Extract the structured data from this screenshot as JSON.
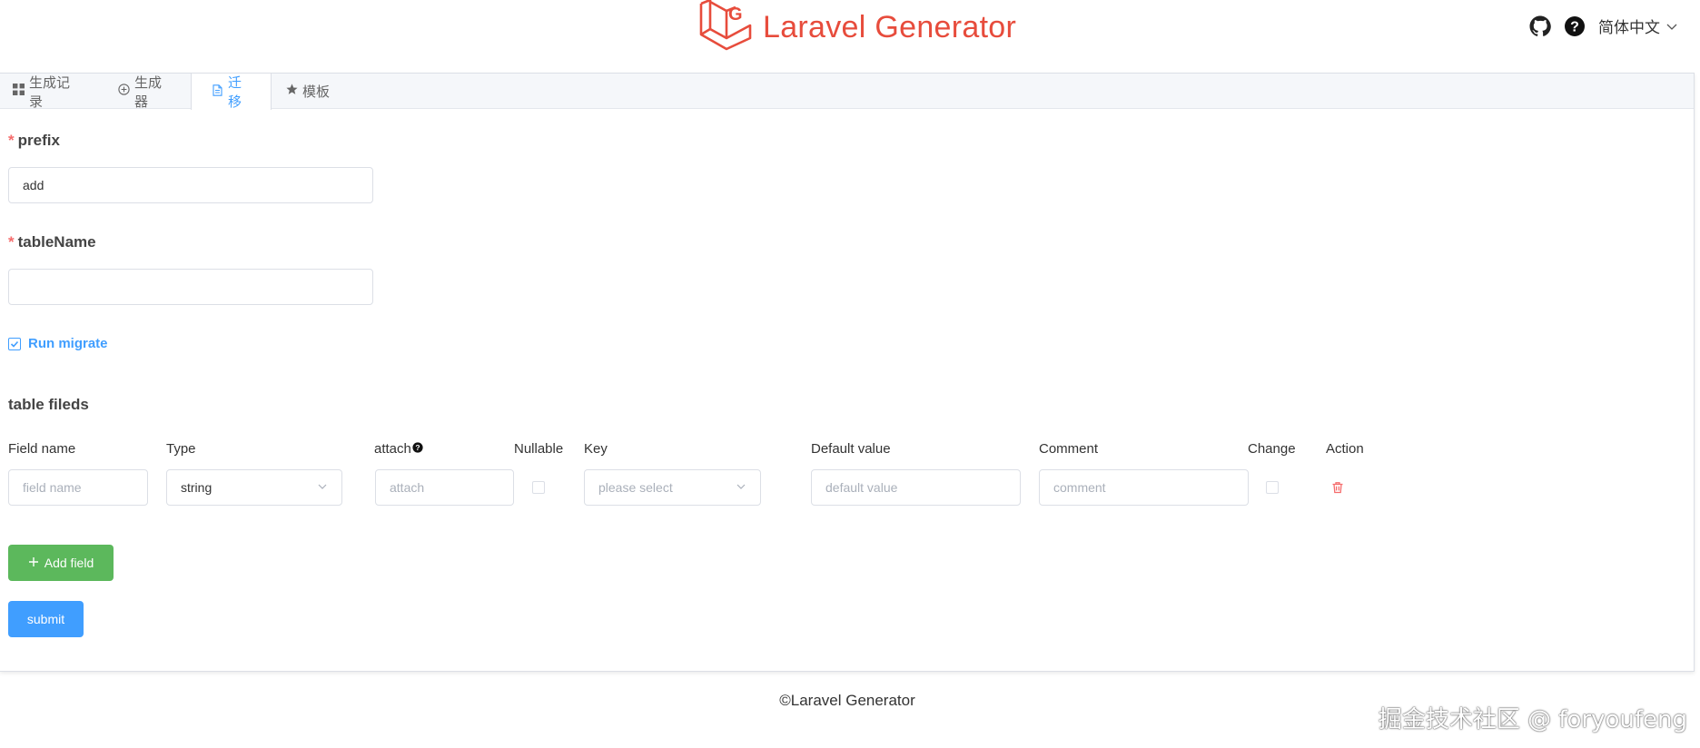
{
  "header": {
    "title": "Laravel Generator",
    "logo_icon": "laravel-generator-logo",
    "github_icon": "github-icon",
    "help_icon": "help-circle-icon",
    "language": "简体中文",
    "brand_color": "#e74c3c"
  },
  "tabs": [
    {
      "label": "生成记录",
      "icon": "grid-icon",
      "active": false
    },
    {
      "label": "生成器",
      "icon": "plus-circle-icon",
      "active": false
    },
    {
      "label": "迁移",
      "icon": "document-icon",
      "active": true
    },
    {
      "label": "模板",
      "icon": "star-icon",
      "active": false
    }
  ],
  "form": {
    "prefix_label": "prefix",
    "prefix_value": "add",
    "table_name_label": "tableName",
    "table_name_value": "",
    "run_migrate_label": "Run migrate",
    "run_migrate_checked": true,
    "section_title": "table fileds"
  },
  "table": {
    "headers": {
      "field_name": "Field name",
      "type": "Type",
      "attach": "attach",
      "nullable": "Nullable",
      "key": "Key",
      "default_value": "Default value",
      "comment": "Comment",
      "change": "Change",
      "action": "Action"
    },
    "row": {
      "field_name_placeholder": "field name",
      "type_value": "string",
      "attach_placeholder": "attach",
      "key_placeholder": "please select",
      "default_value_placeholder": "default value",
      "comment_placeholder": "comment",
      "nullable_checked": false,
      "change_checked": false
    }
  },
  "buttons": {
    "add_field": "Add field",
    "submit": "submit"
  },
  "footer": {
    "copyright": "©Laravel Generator"
  },
  "watermark": "掘金技术社区 @ foryoufeng",
  "colors": {
    "primary": "#409eff",
    "success": "#5cb85c",
    "danger": "#f56c6c"
  }
}
